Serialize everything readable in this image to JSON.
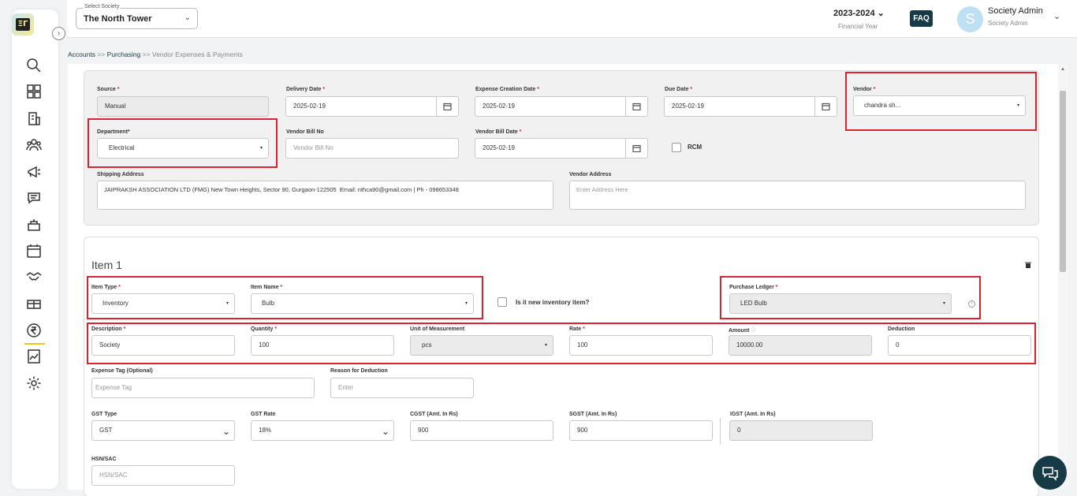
{
  "topbar": {
    "society_label": "Select Society",
    "society_value": "The North Tower",
    "financial_year": "2023-2024",
    "financial_year_label": "Financial Year",
    "faq": "FAQ",
    "avatar_letter": "S",
    "user_name": "Society Admin",
    "user_role": "Society Admin"
  },
  "breadcrumb": {
    "accounts": "Accounts",
    "sep1": ">>",
    "purchasing": "Purchasing",
    "sep2": ">>",
    "current": "Vendor Expenses & Payments"
  },
  "sidebar": {
    "logo_text": "ΞΓ",
    "icons": [
      "search-icon",
      "dashboard-icon",
      "building-icon",
      "community-icon",
      "announcement-icon",
      "chat-icon",
      "facility-icon",
      "calendar-icon",
      "handshake-icon",
      "parking-icon",
      "rupee-icon",
      "report-icon",
      "settings-icon"
    ]
  },
  "form": {
    "source": {
      "label": "Source",
      "value": "Manual"
    },
    "delivery_date": {
      "label": "Delivery Date",
      "value": "2025-02-19"
    },
    "expense_creation_date": {
      "label": "Expense Creation Date",
      "value": "2025-02-19"
    },
    "due_date": {
      "label": "Due Date",
      "value": "2025-02-19"
    },
    "vendor": {
      "label": "Vendor",
      "value": "chandra sh..."
    },
    "department": {
      "label": "Department*",
      "value": "Electrical"
    },
    "vendor_bill_no": {
      "label": "Vendor Bill No",
      "placeholder": "Vendor Bill No"
    },
    "vendor_bill_date": {
      "label": "Vendor Bill Date",
      "value": "2025-02-19"
    },
    "rcm": {
      "label": "RCM"
    },
    "shipping_address": {
      "label": "Shipping Address",
      "value": "JAIPRAKSH ASSOCIATION LTD (FMG) New Town Heights, Sector 90, Gurgaon-122505  Email: nthca90@gmail.com | Ph - 098653348"
    },
    "vendor_address": {
      "label": "Vendor Address",
      "placeholder": "Enter Address Here"
    }
  },
  "item": {
    "title": "Item 1",
    "item_type": {
      "label": "Item Type",
      "value": "Inventory"
    },
    "item_name": {
      "label": "Item Name",
      "value": "Bulb"
    },
    "new_inventory": {
      "label": "Is it new inventory item?"
    },
    "purchase_ledger": {
      "label": "Purchase Ledger",
      "value": "LED Bulb",
      "info": "i"
    },
    "description": {
      "label": "Description",
      "value": "Society"
    },
    "quantity": {
      "label": "Quantity",
      "value": "100"
    },
    "uom": {
      "label": "Unit of Measurement",
      "value": "pcs"
    },
    "rate": {
      "label": "Rate",
      "value": "100"
    },
    "amount": {
      "label": "Amount",
      "value": "10000.00",
      "info": "i"
    },
    "deduction": {
      "label": "Deduction",
      "value": "0"
    },
    "expense_tag": {
      "label": "Expense Tag (Optional)",
      "placeholder": "Expense Tag"
    },
    "reason_deduction": {
      "label": "Reason for Deduction",
      "placeholder": "Enter"
    },
    "gst_type": {
      "label": "GST Type",
      "value": "GST"
    },
    "gst_rate": {
      "label": "GST Rate",
      "value": "18%"
    },
    "cgst": {
      "label": "CGST (Amt. In Rs)",
      "value": "900"
    },
    "sgst": {
      "label": "SGST (Amt. In Rs)",
      "value": "900"
    },
    "igst": {
      "label": "IGST (Amt. In Rs)",
      "value": "0"
    },
    "hsn": {
      "label": "HSN/SAC",
      "placeholder": "HSN/SAC"
    }
  },
  "glyphs": {
    "req": "*",
    "caret": "▾",
    "chevron": "⌄",
    "expand": "›"
  },
  "colors": {
    "accent": "#163a46",
    "required": "#d9232e",
    "highlight": "#d9232e"
  }
}
